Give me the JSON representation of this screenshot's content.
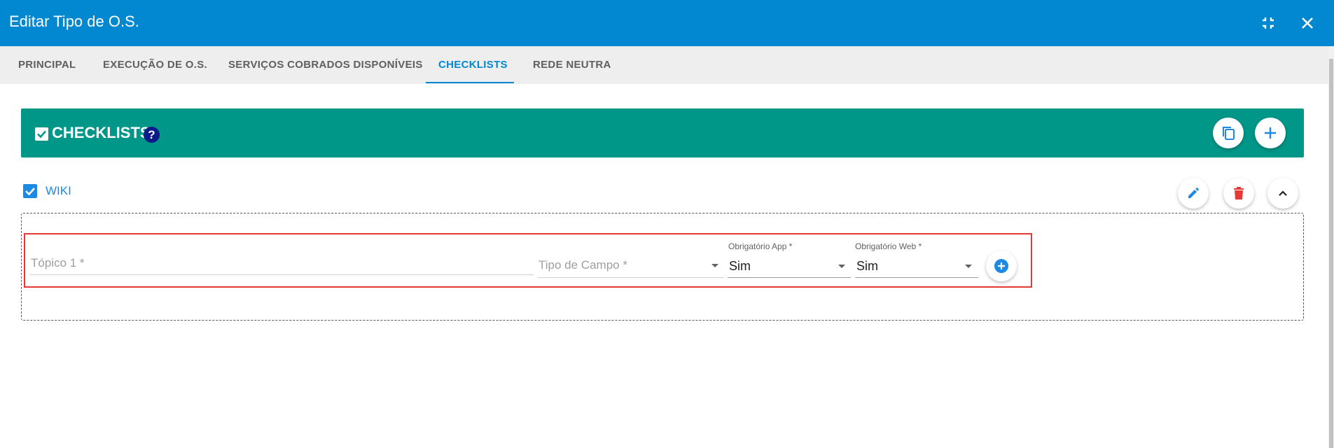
{
  "dialog": {
    "title": "Editar Tipo de O.S.",
    "header_color": "#0288d1",
    "actions": [
      {
        "name": "collapse-icon"
      },
      {
        "name": "close-icon"
      }
    ]
  },
  "tabs": [
    {
      "label": "PRINCIPAL",
      "active": false
    },
    {
      "label": "EXECUÇÃO DE O.S.",
      "active": false
    },
    {
      "label": "SERVIÇOS COBRADOS DISPONÍVEIS",
      "active": false
    },
    {
      "label": "CHECKLISTS",
      "active": true
    },
    {
      "label": "REDE NEUTRA",
      "active": false
    }
  ],
  "section": {
    "title": "CHECKLISTS",
    "help": "?",
    "color": "#009688",
    "actions": [
      {
        "name": "copy-icon"
      },
      {
        "name": "add-icon"
      }
    ]
  },
  "checklist": {
    "name": "WIKI",
    "checked": true,
    "actions": [
      {
        "name": "edit-icon"
      },
      {
        "name": "delete-icon"
      },
      {
        "name": "chevron-up-icon"
      }
    ]
  },
  "topic_row": {
    "topic_placeholder": "Tópico 1 *",
    "field_type_placeholder": "Tipo de Campo *",
    "app_required": {
      "label": "Obrigatório App *",
      "value": "Sim"
    },
    "web_required": {
      "label": "Obrigatório Web *",
      "value": "Sim"
    },
    "add_icon": "add-circle-icon"
  }
}
